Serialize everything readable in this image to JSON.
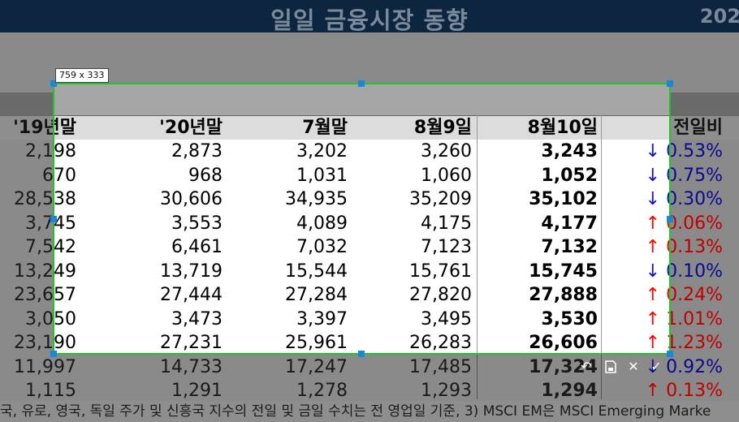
{
  "title": "일일 금융시장 동향",
  "title_year": "202",
  "selection": {
    "size_label": "759 x 333"
  },
  "table": {
    "headers": [
      "'19년말",
      "'20년말",
      "7월말",
      "8월9일",
      "8월10일",
      "전일비"
    ],
    "rows": [
      {
        "c0": "2,198",
        "c1": "2,873",
        "c2": "3,202",
        "c3": "3,260",
        "c4": "3,243",
        "dir": "down",
        "arrow": "↓",
        "chg": "0.53%"
      },
      {
        "c0": "670",
        "c1": "968",
        "c2": "1,031",
        "c3": "1,060",
        "c4": "1,052",
        "dir": "down",
        "arrow": "↓",
        "chg": "0.75%"
      },
      {
        "c0": "28,538",
        "c1": "30,606",
        "c2": "34,935",
        "c3": "35,209",
        "c4": "35,102",
        "dir": "down",
        "arrow": "↓",
        "chg": "0.30%"
      },
      {
        "c0": "3,745",
        "c1": "3,553",
        "c2": "4,089",
        "c3": "4,175",
        "c4": "4,177",
        "dir": "up",
        "arrow": "↑",
        "chg": "0.06%"
      },
      {
        "c0": "7,542",
        "c1": "6,461",
        "c2": "7,032",
        "c3": "7,123",
        "c4": "7,132",
        "dir": "up",
        "arrow": "↑",
        "chg": "0.13%"
      },
      {
        "c0": "13,249",
        "c1": "13,719",
        "c2": "15,544",
        "c3": "15,761",
        "c4": "15,745",
        "dir": "down",
        "arrow": "↓",
        "chg": "0.10%"
      },
      {
        "c0": "23,657",
        "c1": "27,444",
        "c2": "27,284",
        "c3": "27,820",
        "c4": "27,888",
        "dir": "up",
        "arrow": "↑",
        "chg": "0.24%"
      },
      {
        "c0": "3,050",
        "c1": "3,473",
        "c2": "3,397",
        "c3": "3,495",
        "c4": "3,530",
        "dir": "up",
        "arrow": "↑",
        "chg": "1.01%"
      },
      {
        "c0": "23,190",
        "c1": "27,231",
        "c2": "25,961",
        "c3": "26,283",
        "c4": "26,606",
        "dir": "up",
        "arrow": "↑",
        "chg": "1.23%"
      },
      {
        "c0": "11,997",
        "c1": "14,733",
        "c2": "17,247",
        "c3": "17,485",
        "c4": "17,324",
        "dir": "down",
        "arrow": "↓",
        "chg": "0.92%"
      },
      {
        "c0": "1,115",
        "c1": "1,291",
        "c2": "1,278",
        "c3": "1,293",
        "c4": "1,294",
        "dir": "up",
        "arrow": "↑",
        "chg": "0.13%"
      }
    ]
  },
  "footnote": "국, 유로, 영국, 독일 주가 및 신흥국 지수의 전일 및 금일 수치는 전 영업일 기준, 3) MSCI EM은 MSCI Emerging Marke",
  "toolbar": {
    "undo_icon": "undo-icon",
    "save_icon": "save-icon",
    "close_icon": "close-icon",
    "confirm_icon": "check-icon"
  },
  "colors": {
    "selection_border": "#22c32a",
    "handle": "#1b87d6",
    "title_bg": "#0e2540",
    "up": "#ff0000",
    "down": "#1010c8"
  }
}
